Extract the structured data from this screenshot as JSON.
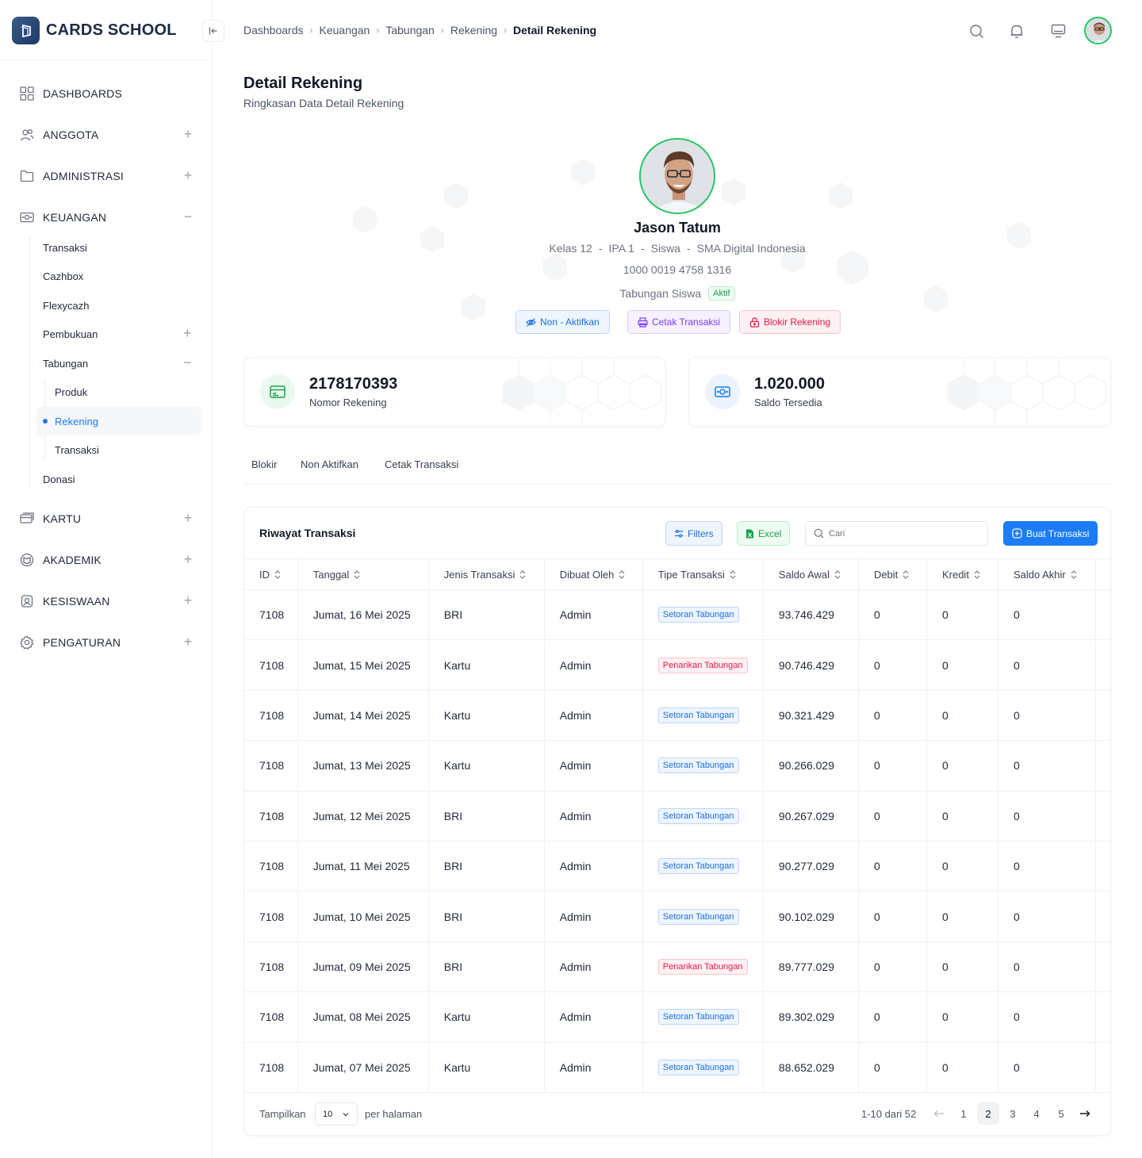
{
  "brand": {
    "name": "CARDS SCHOOL"
  },
  "sidebar": {
    "items": [
      {
        "label": "DASHBOARDS",
        "icon": "grid-icon"
      },
      {
        "label": "ANGGOTA",
        "icon": "users-icon"
      },
      {
        "label": "ADMINISTRASI",
        "icon": "folder-icon"
      },
      {
        "label": "KEUANGAN",
        "icon": "money-icon"
      },
      {
        "label": "KARTU",
        "icon": "card-icon"
      },
      {
        "label": "AKADEMIK",
        "icon": "book-icon"
      },
      {
        "label": "KESISWAAN",
        "icon": "student-icon"
      },
      {
        "label": "PENGATURAN",
        "icon": "gear-icon"
      }
    ],
    "keuangan_sub": [
      "Transaksi",
      "Cazhbox",
      "Flexycazh",
      "Pembukuan",
      "Tabungan",
      "Donasi"
    ],
    "tabungan_sub": [
      "Produk",
      "Rekening",
      "Transaksi"
    ]
  },
  "breadcrumb": [
    "Dashboards",
    "Keuangan",
    "Tabungan",
    "Rekening",
    "Detail Rekening"
  ],
  "page": {
    "title": "Detail Rekening",
    "subtitle": "Ringkasan Data Detail Rekening"
  },
  "profile": {
    "name": "Jason Tatum",
    "kelas": "Kelas 12",
    "jurusan": "IPA 1",
    "role": "Siswa",
    "sekolah": "SMA Digital Indonesia",
    "account_number": "1000 0019 4758 1316",
    "product": "Tabungan Siswa",
    "status": "Aktif",
    "dash": "-",
    "buttons": {
      "deactivate": "Non - Aktifkan",
      "print": "Cetak Transaksi",
      "block": "Blokir Rekening"
    }
  },
  "stats": [
    {
      "value": "2178170393",
      "label": "Nomor Rekening"
    },
    {
      "value": "1.020.000",
      "label": "Saldo Tersedia"
    }
  ],
  "tabs": [
    "Blokir",
    "Non Aktifkan",
    "Cetak Transaksi"
  ],
  "table": {
    "title": "Riwayat Transaksi",
    "filters_label": "Filters",
    "excel_label": "Excel",
    "search_placeholder": "Cari",
    "create_label": "Buat Transaksi",
    "columns": [
      "ID",
      "Tanggal",
      "Jenis Transaksi",
      "Dibuat Oleh",
      "Tipe Transaksi",
      "Saldo Awal",
      "Debit",
      "Kredit",
      "Saldo Akhir"
    ],
    "rows": [
      [
        "7108",
        "Jumat, 16 Mei 2025",
        "BRI",
        "Admin",
        "Setoran Tabungan",
        "93.746.429",
        "0",
        "0",
        "0"
      ],
      [
        "7108",
        "Jumat, 15 Mei 2025",
        "Kartu",
        "Admin",
        "Penarikan Tabungan",
        "90.746.429",
        "0",
        "0",
        "0"
      ],
      [
        "7108",
        "Jumat, 14 Mei 2025",
        "Kartu",
        "Admin",
        "Setoran Tabungan",
        "90.321.429",
        "0",
        "0",
        "0"
      ],
      [
        "7108",
        "Jumat, 13 Mei 2025",
        "Kartu",
        "Admin",
        "Setoran Tabungan",
        "90.266.029",
        "0",
        "0",
        "0"
      ],
      [
        "7108",
        "Jumat, 12 Mei 2025",
        "BRI",
        "Admin",
        "Setoran Tabungan",
        "90.267.029",
        "0",
        "0",
        "0"
      ],
      [
        "7108",
        "Jumat, 11 Mei 2025",
        "BRI",
        "Admin",
        "Setoran Tabungan",
        "90.277.029",
        "0",
        "0",
        "0"
      ],
      [
        "7108",
        "Jumat, 10 Mei 2025",
        "BRI",
        "Admin",
        "Setoran Tabungan",
        "90.102.029",
        "0",
        "0",
        "0"
      ],
      [
        "7108",
        "Jumat, 09 Mei 2025",
        "BRI",
        "Admin",
        "Penarikan Tabungan",
        "89.777.029",
        "0",
        "0",
        "0"
      ],
      [
        "7108",
        "Jumat, 08 Mei 2025",
        "Kartu",
        "Admin",
        "Setoran Tabungan",
        "89.302.029",
        "0",
        "0",
        "0"
      ],
      [
        "7108",
        "Jumat, 07 Mei 2025",
        "Kartu",
        "Admin",
        "Setoran Tabungan",
        "88.652.029",
        "0",
        "0",
        "0"
      ]
    ]
  },
  "pagination": {
    "show_label": "Tampilkan",
    "per_page": "10",
    "per_page_label": "per halaman",
    "range": "1-10 dari 52",
    "pages": [
      "1",
      "2",
      "3",
      "4",
      "5"
    ],
    "current": "2"
  },
  "colors": {
    "accent": "#1b7cf5",
    "success": "#22c55e",
    "danger": "#e11d48",
    "purple": "#7c3aed"
  }
}
